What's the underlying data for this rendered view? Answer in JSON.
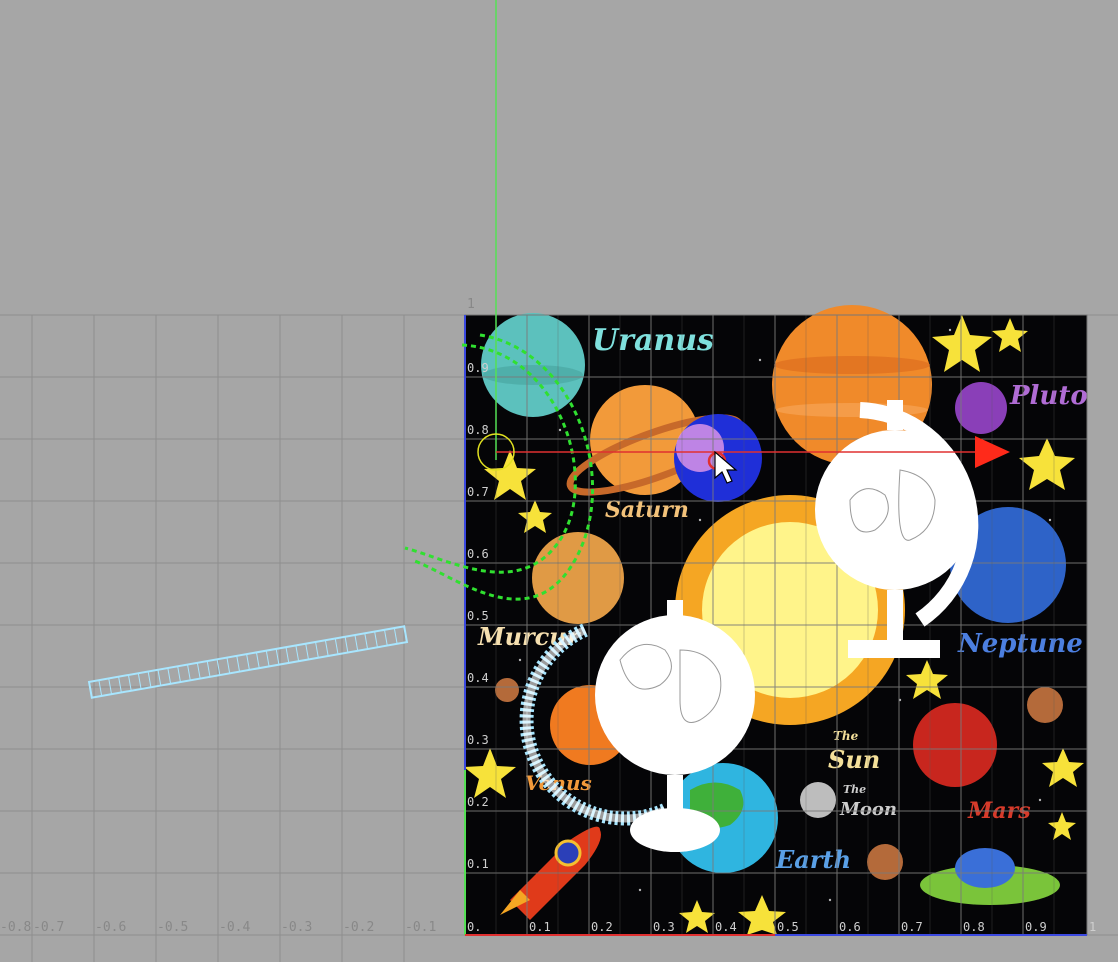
{
  "editor": {
    "name": "UV editor viewport",
    "texture": {
      "planet_labels": [
        {
          "key": "uranus",
          "text": "Uranus",
          "color": "#7fe0dd"
        },
        {
          "key": "pluto",
          "text": "Pluto",
          "color": "#b06cd4"
        },
        {
          "key": "saturn",
          "text": "Saturn",
          "color": "#f3c27a"
        },
        {
          "key": "murcury",
          "text": "Murcur",
          "color": "#f6e0b0"
        },
        {
          "key": "neptune",
          "text": "Neptune",
          "color": "#4c7fe0"
        },
        {
          "key": "venus",
          "text": "Venus",
          "color": "#f39a3a"
        },
        {
          "key": "the-sun-small",
          "text": "The",
          "color": "#f4e09a"
        },
        {
          "key": "sun",
          "text": "Sun",
          "color": "#f4e09a"
        },
        {
          "key": "the-moon-small",
          "text": "The",
          "color": "#cccccc"
        },
        {
          "key": "moon",
          "text": "Moon",
          "color": "#cccccc"
        },
        {
          "key": "mars",
          "text": "Mars",
          "color": "#d63a2a"
        },
        {
          "key": "earth",
          "text": "Earth",
          "color": "#5aa0e6"
        }
      ]
    },
    "x_axis_labels": [
      "-0.8",
      "-0.7",
      "-0.6",
      "-0.5",
      "-0.4",
      "-0.3",
      "-0.2",
      "-0.1",
      "0.",
      "0.1",
      "0.2",
      "0.3",
      "0.4",
      "0.5",
      "0.6",
      "0.7",
      "0.8",
      "0.9",
      "1"
    ],
    "y_axis_labels": [
      "1",
      "0.9",
      "0.8",
      "0.7",
      "0.6",
      "0.5",
      "0.4",
      "0.3",
      "0.2",
      "0.1"
    ],
    "colors": {
      "background": "#a6a6a6",
      "grid": "#8e8e8e",
      "uv_grid": "#7a7a7a",
      "v_axis": "#55e055",
      "u_axis": "#e03030",
      "uv_selection": "#30e030",
      "uv_unselected": "#a8e6ff",
      "texture_bg": "#050507"
    }
  }
}
